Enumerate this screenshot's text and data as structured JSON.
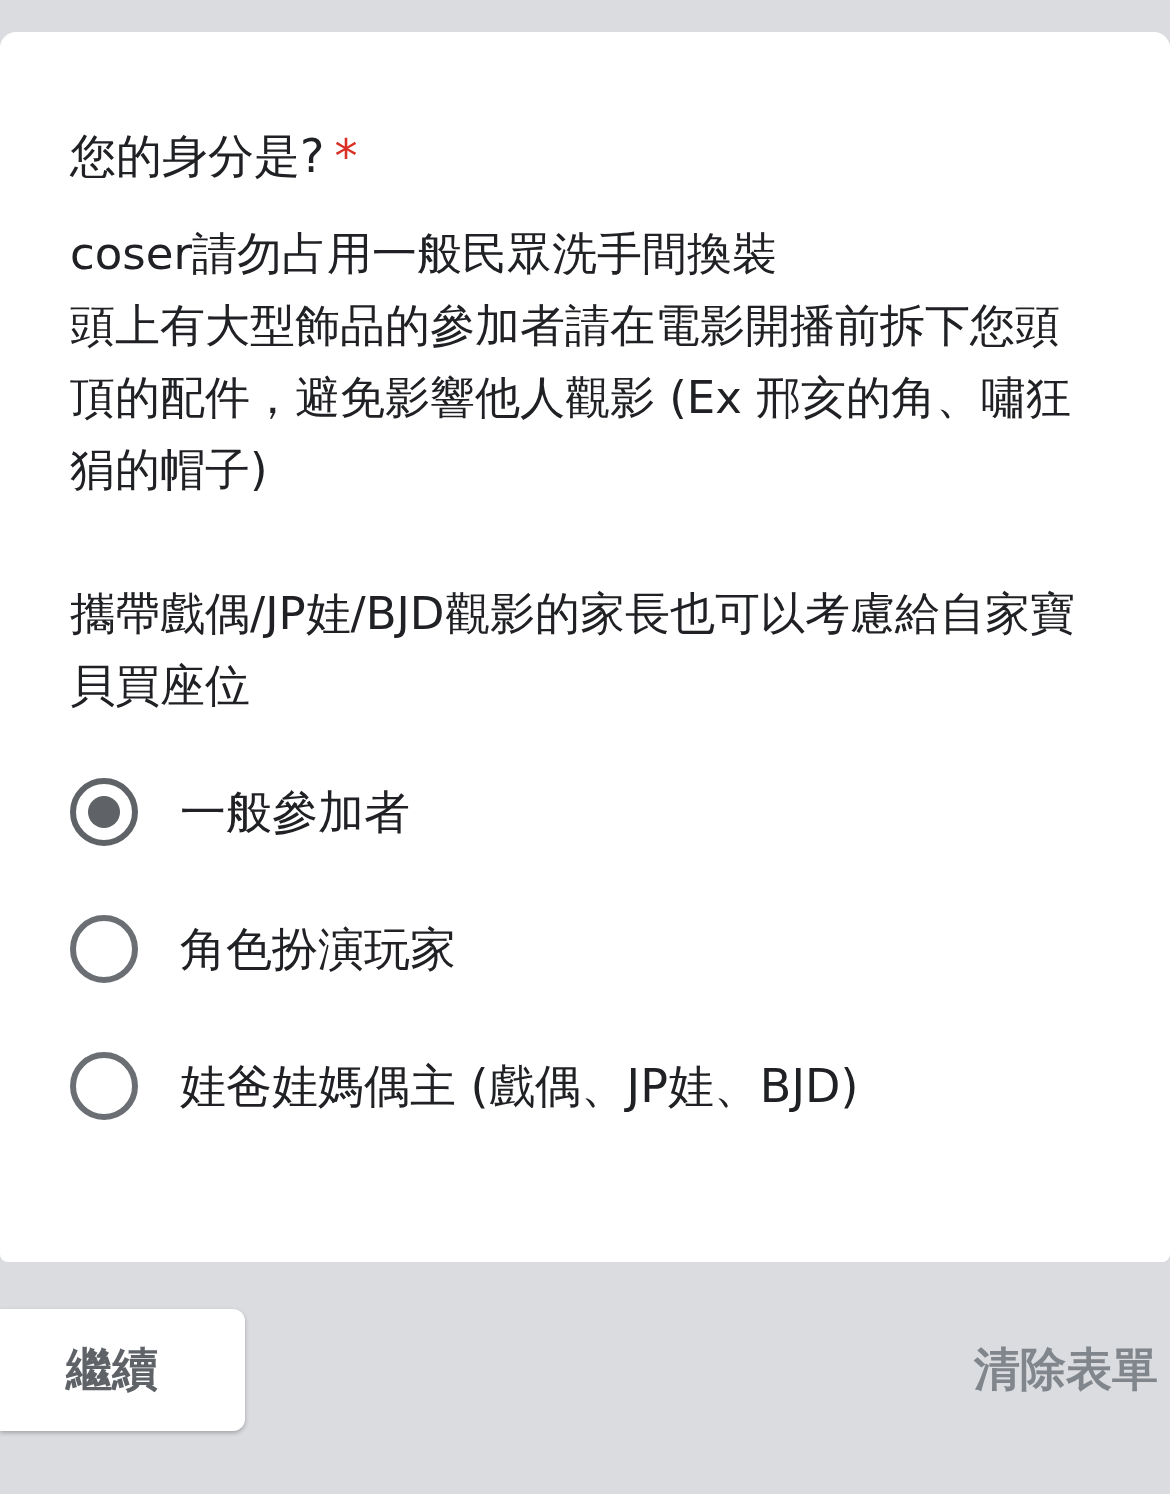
{
  "question": {
    "title": "您的身分是?",
    "required_mark": "*"
  },
  "description": [
    [
      "coser請勿占用一般民眾洗手間換裝",
      "頭上有大型飾品的參加者請在電影開播前拆下您頭頂的配件，避免影響他人觀影 (Ex 邢亥的角、嘯狂狷的帽子)"
    ],
    [
      "攜帶戲偶/JP娃/BJD觀影的家長也可以考慮給自家寶貝買座位"
    ]
  ],
  "options": [
    {
      "label": "一般參加者",
      "selected": true
    },
    {
      "label": "角色扮演玩家",
      "selected": false
    },
    {
      "label": "娃爸娃媽偶主 (戲偶、JP娃、BJD)",
      "selected": false
    }
  ],
  "buttons": {
    "next": "繼續",
    "clear": "清除表單"
  }
}
